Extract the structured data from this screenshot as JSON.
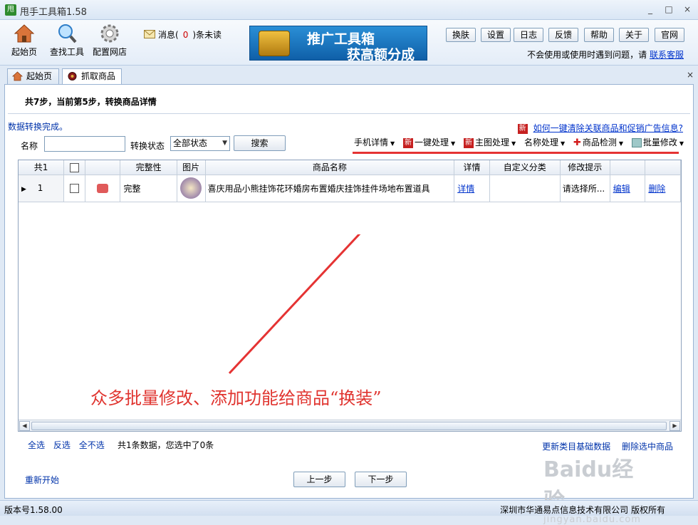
{
  "window": {
    "logo_text": "甩",
    "title": "甩手工具箱1.58",
    "minimize": "_",
    "maximize": "□",
    "close": "×"
  },
  "toolbar": {
    "home_label": "起始页",
    "find_tools_label": "查找工具",
    "config_label": "配置网店",
    "message_prefix": "消息(",
    "message_count": "0",
    "message_suffix": ")条未读",
    "banner_line1": "推广工具箱",
    "banner_line2": "获高额分成",
    "buttons": [
      "换肤",
      "设置",
      "日志",
      "反馈",
      "帮助",
      "关于",
      "官网"
    ],
    "help_text": "不会使用或使用时遇到问题，请",
    "help_link": "联系客服"
  },
  "tabs": [
    {
      "label": "起始页",
      "active": false
    },
    {
      "label": "抓取商品",
      "active": true
    }
  ],
  "tab_close": "×",
  "main": {
    "steps_text": "共7步，当前第5步，转换商品详情",
    "status_text": "数据转换完成。",
    "new_tag": "新",
    "faq_link": "如何一键清除关联商品和促销广告信息?",
    "name_label": "名称",
    "name_value": "",
    "state_label": "转换状态",
    "state_value": "全部状态",
    "search_button": "搜索",
    "actions": [
      {
        "label": "手机详情",
        "icon": "none"
      },
      {
        "label": "一键处理",
        "icon": "new-tag"
      },
      {
        "label": "主图处理",
        "icon": "new-tag"
      },
      {
        "label": "名称处理",
        "icon": "none"
      },
      {
        "label": "商品检测",
        "icon": "red-cross"
      },
      {
        "label": "批量修改",
        "icon": "batch-icon"
      }
    ],
    "dropdown_glyph": "▼"
  },
  "table": {
    "headers": [
      "共1",
      "",
      "",
      "完整性",
      "图片",
      "商品名称",
      "详情",
      "自定义分类",
      "修改提示",
      "",
      ""
    ],
    "rows": [
      {
        "marker": "▶",
        "index": "1",
        "completeness": "完整",
        "name": "喜庆用品小熊挂饰花环婚房布置婚庆挂饰挂件场地布置道具",
        "detail": "详情",
        "category": "",
        "hint": "请选择所...",
        "edit": "编辑",
        "delete": "删除"
      }
    ]
  },
  "annotation": "众多批量修改、添加功能给商品“换装”",
  "footer": {
    "select_all": "全选",
    "invert": "反选",
    "select_none": "全不选",
    "summary": "共1条数据，您选中了0条",
    "update_category": "更新类目基础数据",
    "delete_selected": "删除选中商品",
    "restart": "重新开始",
    "prev": "上一步",
    "next": "下一步"
  },
  "watermark": {
    "brand": "Baidu经验",
    "sub": "jingyan.baidu.com"
  },
  "statusbar": {
    "version": "版本号1.58.00",
    "company": "深圳市华通易点信息技术有限公司 版权所有"
  },
  "colors": {
    "accent_red": "#e53333",
    "link_blue": "#0033cc",
    "frame_blue": "#dfe9f5"
  }
}
